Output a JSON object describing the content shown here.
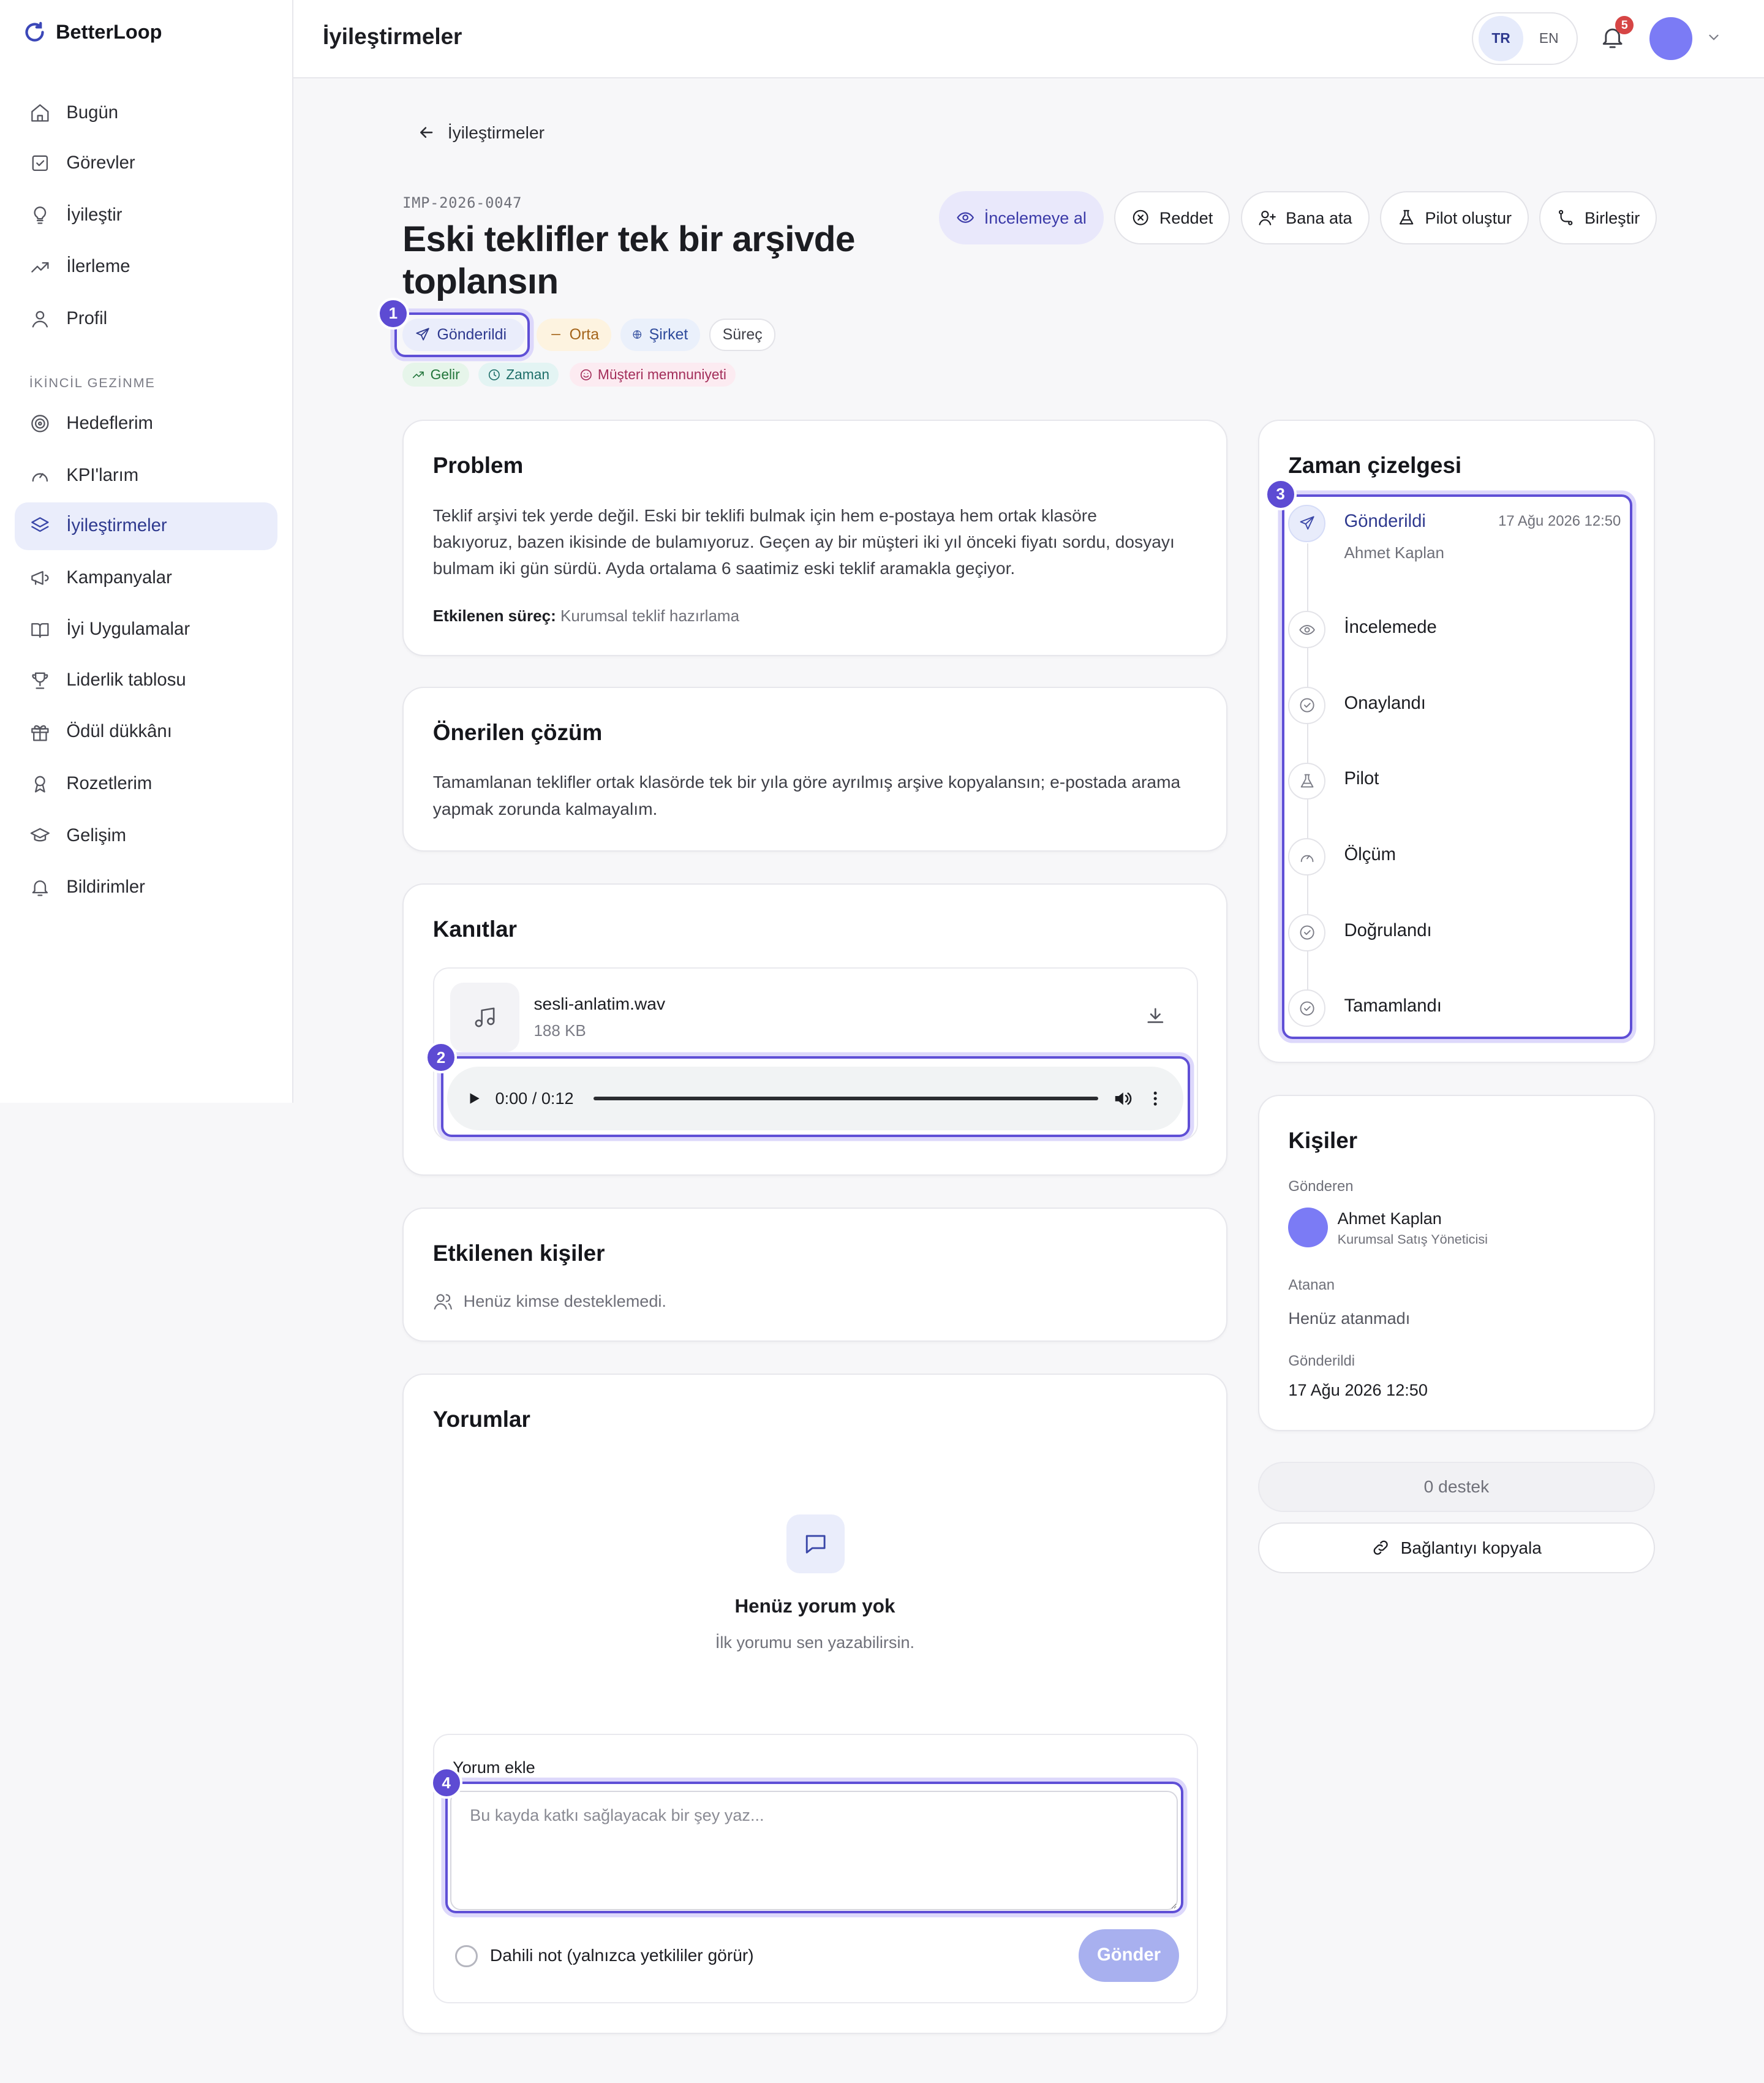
{
  "brand": {
    "name": "BetterLoop",
    "accent": "#3b47b8"
  },
  "sidebar": {
    "primary": [
      {
        "label": "Bugün",
        "icon": "home-icon"
      },
      {
        "label": "Görevler",
        "icon": "checkbox-icon"
      },
      {
        "label": "İyileştir",
        "icon": "lightbulb-icon"
      },
      {
        "label": "İlerleme",
        "icon": "trend-up-icon"
      },
      {
        "label": "Profil",
        "icon": "user-icon"
      }
    ],
    "section_label": "İKİNCİL GEZİNME",
    "secondary": [
      {
        "label": "Hedeflerim",
        "icon": "target-icon"
      },
      {
        "label": "KPI'larım",
        "icon": "gauge-icon"
      },
      {
        "label": "İyileştirmeler",
        "icon": "layers-icon",
        "active": true
      },
      {
        "label": "Kampanyalar",
        "icon": "megaphone-icon"
      },
      {
        "label": "İyi Uygulamalar",
        "icon": "book-icon"
      },
      {
        "label": "Liderlik tablosu",
        "icon": "trophy-icon"
      },
      {
        "label": "Ödül dükkânı",
        "icon": "gift-icon"
      },
      {
        "label": "Rozetlerim",
        "icon": "badge-icon"
      },
      {
        "label": "Gelişim",
        "icon": "graduation-cap-icon"
      },
      {
        "label": "Bildirimler",
        "icon": "bell-icon"
      }
    ]
  },
  "header": {
    "title": "İyileştirmeler",
    "languages": [
      "TR",
      "EN"
    ],
    "active_language": "TR",
    "notification_count": "5",
    "avatar_color": "#7b7bf5"
  },
  "breadcrumb": {
    "back_label": "İyileştirmeler"
  },
  "improvement": {
    "id": "IMP-2026-0047",
    "title": "Eski teklifler tek bir arşivde toplansın",
    "status": "Gönderildi",
    "priority": "Orta",
    "scope": "Şirket",
    "category": "Süreç",
    "impact_tags": [
      "Gelir",
      "Zaman",
      "Müşteri memnuniyeti"
    ]
  },
  "actions": [
    "İncelemeye al",
    "Reddet",
    "Bana ata",
    "Pilot oluştur",
    "Birleştir"
  ],
  "problem": {
    "title": "Problem",
    "text": "Teklif arşivi tek yerde değil. Eski bir teklifi bulmak için hem e-postaya hem ortak klasöre bakıyoruz, bazen ikisinde de bulamıyoruz. Geçen ay bir müşteri iki yıl önceki fiyatı sordu, dosyayı bulmam iki gün sürdü. Ayda ortalama 6 saatimiz eski teklif aramakla geçiyor.",
    "process_label": "Etkilenen süreç:",
    "process_value": "Kurumsal teklif hazırlama"
  },
  "solution": {
    "title": "Önerilen çözüm",
    "text": "Tamamlanan teklifler ortak klasörde tek bir yıla göre ayrılmış arşive kopyalansın; e-postada arama yapmak zorunda kalmayalım."
  },
  "evidence": {
    "title": "Kanıtlar",
    "file_name": "sesli-anlatim.wav",
    "file_size": "188 KB",
    "audio_time": "0:00 / 0:12"
  },
  "affected": {
    "title": "Etkilenen kişiler",
    "empty_text": "Henüz kimse desteklemedi."
  },
  "comments": {
    "title": "Yorumlar",
    "empty_title": "Henüz yorum yok",
    "empty_subtitle": "İlk yorumu sen yazabilirsin.",
    "add_label": "Yorum ekle",
    "placeholder": "Bu kayda katkı sağlayacak bir şey yaz...",
    "internal_note_label": "Dahili not (yalnızca yetkililer görür)",
    "send_label": "Gönder"
  },
  "timeline": {
    "title": "Zaman çizelgesi",
    "steps": [
      {
        "label": "Gönderildi",
        "date": "17 Ağu 2026 12:50",
        "person": "Ahmet Kaplan",
        "icon": "send-icon",
        "active": true
      },
      {
        "label": "İncelemede",
        "icon": "eye-icon"
      },
      {
        "label": "Onaylandı",
        "icon": "check-circle-icon"
      },
      {
        "label": "Pilot",
        "icon": "flask-icon"
      },
      {
        "label": "Ölçüm",
        "icon": "gauge-icon"
      },
      {
        "label": "Doğrulandı",
        "icon": "check-circle-icon"
      },
      {
        "label": "Tamamlandı",
        "icon": "check-circle-icon"
      }
    ]
  },
  "people": {
    "title": "Kişiler",
    "submitter_label": "Gönderen",
    "submitter_name": "Ahmet Kaplan",
    "submitter_role": "Kurumsal Satış Yöneticisi",
    "assignee_label": "Atanan",
    "assignee_value": "Henüz atanmadı",
    "submitted_label": "Gönderildi",
    "submitted_value": "17 Ağu 2026 12:50"
  },
  "support": {
    "count_label": "0 destek",
    "copy_link_label": "Bağlantıyı kopyala"
  },
  "markers": [
    "1",
    "2",
    "3",
    "4"
  ]
}
